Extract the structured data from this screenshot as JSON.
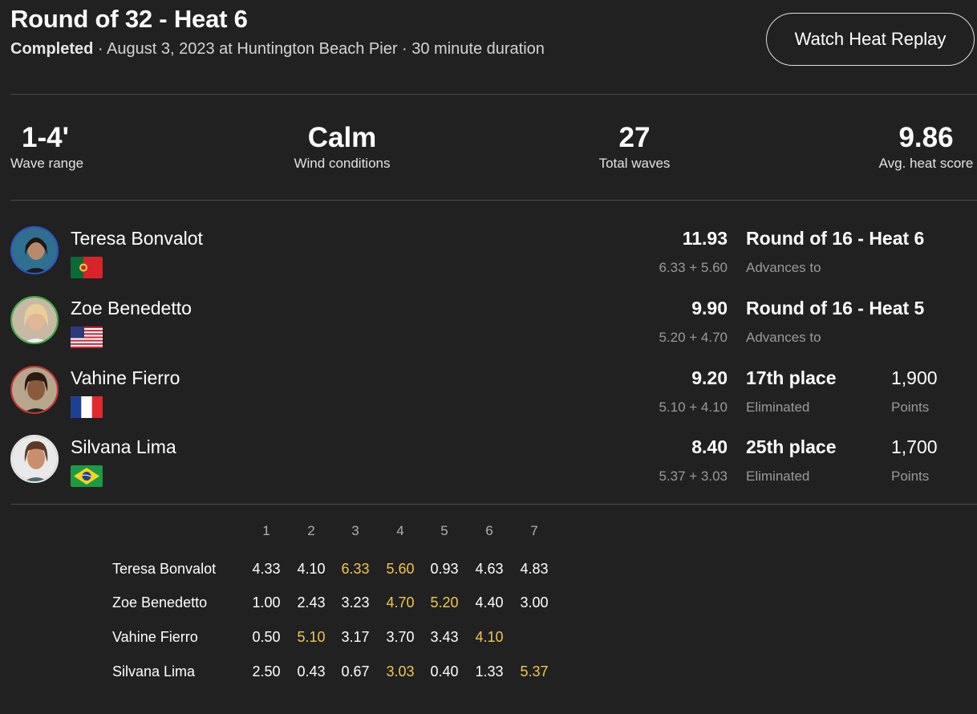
{
  "header": {
    "title": "Round of 32 - Heat 6",
    "status": "Completed",
    "meta": " · August 3, 2023 at Huntington Beach Pier · 30 minute duration",
    "replay_label": "Watch Heat Replay"
  },
  "stats": [
    {
      "value": "1-4'",
      "label": "Wave range"
    },
    {
      "value": "Calm",
      "label": "Wind conditions"
    },
    {
      "value": "27",
      "label": "Total waves"
    },
    {
      "value": "9.86",
      "label": "Avg. heat score"
    }
  ],
  "colors": {
    "background": "#212121",
    "counted_wave": "#f2c64d",
    "muted_text": "#9a9a9a"
  },
  "surfers": [
    {
      "name": "Teresa Bonvalot",
      "country_flag": "portugal-flag",
      "avatar_ring": "#2e56c9",
      "total": "11.93",
      "breakdown": "6.33 + 5.60",
      "result": "Round of 16 - Heat 6",
      "result_sub": "Advances to",
      "points": "",
      "points_sub": ""
    },
    {
      "name": "Zoe Benedetto",
      "country_flag": "usa-flag",
      "avatar_ring": "#3fae49",
      "total": "9.90",
      "breakdown": "5.20 + 4.70",
      "result": "Round of 16 - Heat 5",
      "result_sub": "Advances to",
      "points": "",
      "points_sub": ""
    },
    {
      "name": "Vahine Fierro",
      "country_flag": "france-flag",
      "avatar_ring": "#c9322f",
      "total": "9.20",
      "breakdown": "5.10 + 4.10",
      "result": "17th place",
      "result_sub": "Eliminated",
      "points": "1,900",
      "points_sub": "Points"
    },
    {
      "name": "Silvana Lima",
      "country_flag": "brazil-flag",
      "avatar_ring": "#e8e8e8",
      "total": "8.40",
      "breakdown": "5.37 + 3.03",
      "result": "25th place",
      "result_sub": "Eliminated",
      "points": "1,700",
      "points_sub": "Points"
    }
  ],
  "wave_table": {
    "headers": [
      "1",
      "2",
      "3",
      "4",
      "5",
      "6",
      "7"
    ],
    "rows": [
      {
        "name": "Teresa Bonvalot",
        "scores": [
          "4.33",
          "4.10",
          "6.33",
          "5.60",
          "0.93",
          "4.63",
          "4.83"
        ],
        "counted": [
          2,
          3
        ]
      },
      {
        "name": "Zoe Benedetto",
        "scores": [
          "1.00",
          "2.43",
          "3.23",
          "4.70",
          "5.20",
          "4.40",
          "3.00"
        ],
        "counted": [
          3,
          4
        ]
      },
      {
        "name": "Vahine Fierro",
        "scores": [
          "0.50",
          "5.10",
          "3.17",
          "3.70",
          "3.43",
          "4.10",
          ""
        ],
        "counted": [
          1,
          5
        ]
      },
      {
        "name": "Silvana Lima",
        "scores": [
          "2.50",
          "0.43",
          "0.67",
          "3.03",
          "0.40",
          "1.33",
          "5.37"
        ],
        "counted": [
          3,
          6
        ]
      }
    ]
  }
}
